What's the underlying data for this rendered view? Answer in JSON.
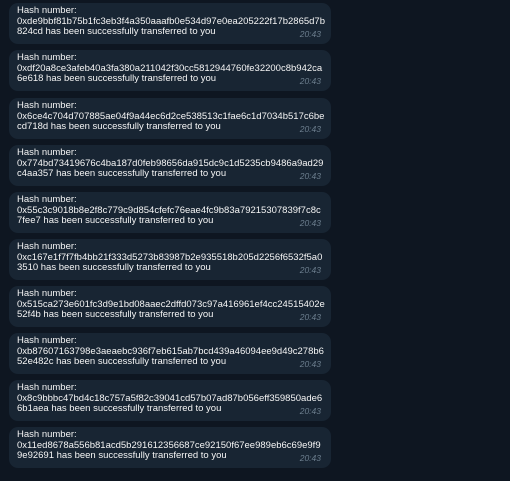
{
  "messages": [
    {
      "title": "Hash number:",
      "body": "0xde9bbf81b75b1fc3eb3f4a350aaafb0e534d97e0ea205222f17b2865d7b824cd has been successfully transferred to you",
      "time": "20:43"
    },
    {
      "title": "Hash number:",
      "body": "0xdf20a8ce3afeb40a3fa380a211042f30cc5812944760fe32200c8b942ca6e618 has been successfully transferred to you",
      "time": "20:43"
    },
    {
      "title": "Hash number:",
      "body": "0x6ce4c704d707885ae04f9a44ec6d2ce538513c1fae6c1d7034b517c6becd718d has been successfully transferred to you",
      "time": "20:43"
    },
    {
      "title": "Hash number:",
      "body": "0x774bd73419676c4ba187d0feb98656da915dc9c1d5235cb9486a9ad29c4aa357 has been successfully transferred to you",
      "time": "20:43"
    },
    {
      "title": "Hash number:",
      "body": "0x55c3c9018b8e2f8c779c9d854cfefc76eae4fc9b83a79215307839f7c8c7fee7 has been successfully transferred to you",
      "time": "20:43"
    },
    {
      "title": "Hash number:",
      "body": "0xc167e1f7f7fb4bb21f333d5273b83987b2e935518b205d2256f6532f5a03510 has been successfully transferred to you",
      "time": "20:43"
    },
    {
      "title": "Hash number:",
      "body": "0x515ca273e601fc3d9e1bd08aaec2dffd073c97a416961ef4cc24515402e52f4b has been successfully transferred to you",
      "time": "20:43"
    },
    {
      "title": "Hash number:",
      "body": "0xb87607163798e3aeaebc936f7eb615ab7bcd439a46094ee9d49c278b652e482c has been successfully transferred to you",
      "time": "20:43"
    },
    {
      "title": "Hash number:",
      "body": "0x8c9bbbc47bd4c18c757a5f82c39041cd57b07ad87b056eff359850ade66b1aea has been successfully transferred to you",
      "time": "20:43"
    },
    {
      "title": "Hash number:",
      "body": "0x11ed8678a556b81acd5b291612356687ce92150f67ee989eb6c69e9f99e92691 has been successfully transferred to you",
      "time": "20:43"
    }
  ]
}
